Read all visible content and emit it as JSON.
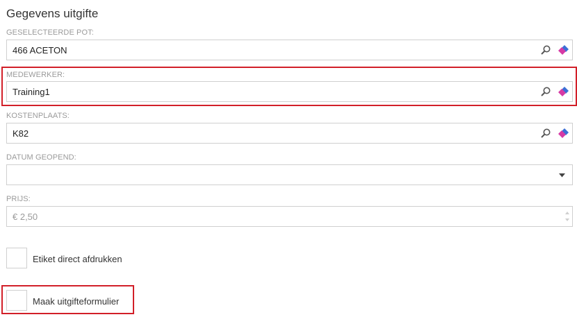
{
  "form": {
    "title": "Gegevens uitgifte",
    "pot": {
      "label": "GESELECTEERDE POT:",
      "value": "466 ACETON"
    },
    "medewerker": {
      "label": "MEDEWERKER:",
      "value": "Training1"
    },
    "kostenplaats": {
      "label": "KOSTENPLAATS:",
      "value": "K82"
    },
    "datum": {
      "label": "DATUM GEOPEND:",
      "value": ""
    },
    "prijs": {
      "label": "PRIJS:",
      "placeholder": "€ 2,50"
    },
    "etiket_label": "Etiket direct afdrukken",
    "formulier_label": "Maak uitgifteformulier"
  },
  "icons": {
    "search": "search-icon",
    "eraser": "eraser-icon",
    "dropdown": "chevron-down-icon"
  },
  "colors": {
    "highlight": "#d21f28",
    "eraser_pink": "#d63aa5",
    "eraser_blue": "#3b6fd6"
  }
}
